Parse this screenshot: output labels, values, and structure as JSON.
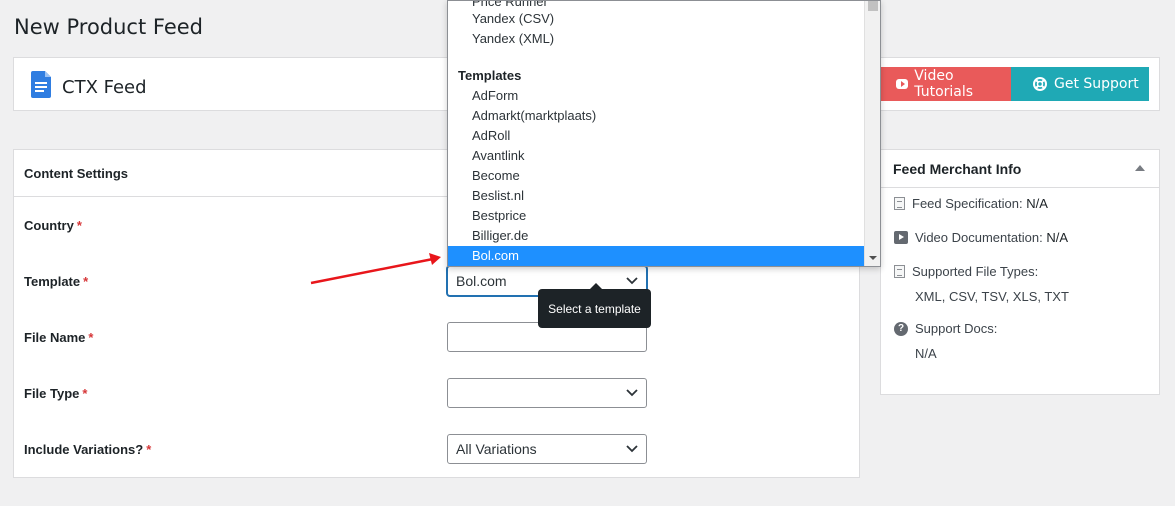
{
  "page_title": "New Product Feed",
  "brand": {
    "name": "CTX Feed",
    "video_tutorials": "Video Tutorials",
    "get_support": "Get Support",
    "colors": {
      "video": "#e95a5a",
      "support": "#1fa9b5"
    }
  },
  "content_settings": {
    "title": "Content Settings",
    "fields": {
      "country": {
        "label": "Country",
        "required": "*"
      },
      "template": {
        "label": "Template",
        "required": "*",
        "value": "Bol.com",
        "tooltip": "Select a template"
      },
      "file_name": {
        "label": "File Name",
        "required": "*",
        "value": ""
      },
      "file_type": {
        "label": "File Type",
        "required": "*",
        "value": ""
      },
      "include_variations": {
        "label": "Include Variations?",
        "required": "*",
        "value": "All Variations"
      }
    }
  },
  "template_dropdown": {
    "options_top": [
      "Price Runner",
      "Yandex (CSV)",
      "Yandex (XML)"
    ],
    "group_label": "Templates",
    "options": [
      "AdForm",
      "Admarkt(marktplaats)",
      "AdRoll",
      "Avantlink",
      "Become",
      "Beslist.nl",
      "Bestprice",
      "Billiger.de",
      "Bol.com"
    ],
    "selected": "Bol.com",
    "selected_color": "#1e90ff"
  },
  "merchant_info": {
    "title": "Feed Merchant Info",
    "feed_specification": {
      "label": "Feed Specification:",
      "value": "N/A",
      "icon": "document-icon"
    },
    "video_documentation": {
      "label": "Video Documentation:",
      "value": "N/A",
      "icon": "video-icon"
    },
    "supported_file_types": {
      "label": "Supported File Types:",
      "value": "XML, CSV, TSV, XLS, TXT",
      "icon": "document-icon"
    },
    "support_docs": {
      "label": "Support Docs:",
      "value": "N/A",
      "icon": "help-icon"
    }
  }
}
